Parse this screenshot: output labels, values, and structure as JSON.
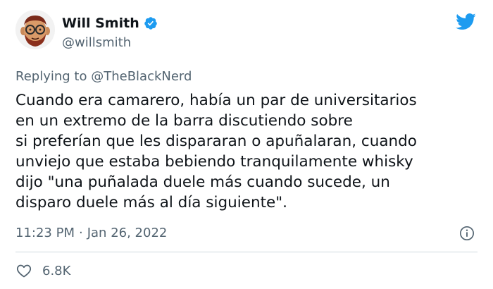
{
  "author": {
    "display_name": "Will Smith",
    "handle": "@willsmith",
    "verified": true,
    "avatar_icon": "cartoon-face-avatar-icon"
  },
  "reply_context": {
    "prefix": "Replying to",
    "mention": "@TheBlackNerd"
  },
  "tweet": {
    "text": "Cuando era camarero, había un par de universitarios\nen un extremo de la barra discutiendo sobre\nsi preferían que les dispararan o apuñalaran, cuando\nunviejo que estaba bebiendo tranquilamente whisky\ndijo \"una puñalada duele más cuando sucede, un\ndisparo duele más al día siguiente\".",
    "time": "11:23 PM",
    "separator": "·",
    "date": "Jan 26, 2022"
  },
  "engagement": {
    "likes": "6.8K"
  },
  "colors": {
    "twitter_blue": "#1d9bf0",
    "text": "#0f1419",
    "secondary": "#536471",
    "divider": "#cfd9de"
  }
}
